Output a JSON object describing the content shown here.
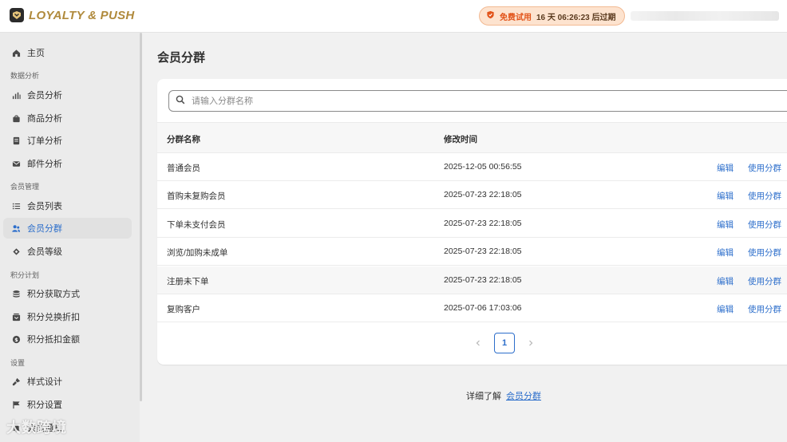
{
  "app": {
    "brand": "LOYALTY & PUSH",
    "trial_free": "免费试用",
    "trial_time": "16 天 06:26:23 后过期"
  },
  "sidebar": {
    "home": "主页",
    "sec_analytics": "数据分析",
    "member_analytics": "会员分析",
    "product_analytics": "商品分析",
    "order_analytics": "订单分析",
    "email_analytics": "邮件分析",
    "sec_members": "会员管理",
    "member_list": "会员列表",
    "member_segments": "会员分群",
    "member_levels": "会员等级",
    "sec_points": "积分计划",
    "points_earn": "积分获取方式",
    "points_redeem": "积分兑换折扣",
    "points_deduct": "积分抵扣金额",
    "sec_settings": "设置",
    "style_design": "样式设计",
    "points_settings": "积分设置",
    "member_notify": "会员通知"
  },
  "main": {
    "title": "会员分群",
    "search_placeholder": "请输入分群名称",
    "col_name": "分群名称",
    "col_modified": "修改时间",
    "edit_label": "编辑",
    "use_label": "使用分群",
    "rows": [
      {
        "name": "普通会员",
        "modified": "2025-12-05 00:56:55"
      },
      {
        "name": "首购未复购会员",
        "modified": "2025-07-23 22:18:05"
      },
      {
        "name": "下单未支付会员",
        "modified": "2025-07-23 22:18:05"
      },
      {
        "name": "浏览/加购未成单",
        "modified": "2025-07-23 22:18:05"
      },
      {
        "name": "注册未下单",
        "modified": "2025-07-23 22:18:05"
      },
      {
        "name": "复购客户",
        "modified": "2025-07-06 17:03:06"
      }
    ],
    "page": "1",
    "footer_text": "详细了解",
    "footer_link": "会员分群"
  },
  "watermark": "大数跨境",
  "colors": {
    "accent": "#2c6ecb",
    "brand_gold": "#b08a3c",
    "trial_orange": "#e2541a"
  }
}
